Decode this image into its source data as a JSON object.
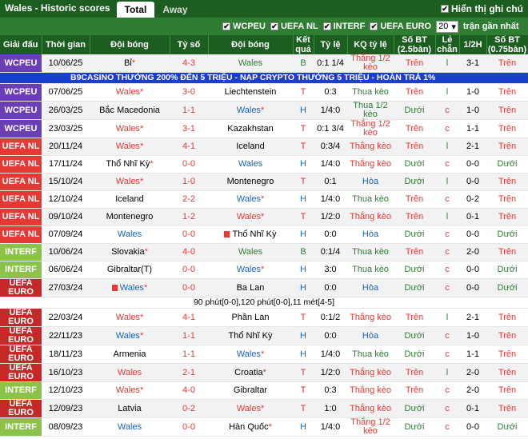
{
  "header": {
    "title": "Wales - Historic scores",
    "tabs": [
      "Total",
      "Away"
    ],
    "show_full_label": "Hiển thị ghi chú"
  },
  "filters": {
    "items": [
      "WCPEU",
      "UEFA NL",
      "INTERF",
      "UEFA EURO"
    ],
    "count_value": "20",
    "recent_label": "trận gần nhất"
  },
  "columns": [
    "Giải đấu",
    "Thời gian",
    "Đội bóng",
    "Tỷ số",
    "Đội bóng",
    "Kết quả",
    "Tỷ lệ",
    "KQ tỷ lệ",
    "Số BT (2.5bàn)",
    "Lẻ chẵn",
    "1/2H",
    "Số BT (0.75bàn)"
  ],
  "comp_colors": {
    "WCPEU": "#6a3fb5",
    "UEFA NL": "#e53935",
    "INTERF": "#8bc34a",
    "UEFA EURO": "#c62828"
  },
  "ad_text": "B9CASINO THƯỞNG 200% ĐẾN 5 TRIỆU - NẠP CRYPTO THƯỞNG 5 TRIỆU - HOÀN TRẢ 1%",
  "note_text": "90 phút[0-0],120 phút[0-0],11 mét[4-5]",
  "rows": [
    {
      "comp": "WCPEU",
      "date": "10/06/25",
      "home": "Bỉ",
      "home_star": true,
      "home_class": "",
      "score": "4-3",
      "away": "Wales",
      "away_star": false,
      "away_class": "green",
      "res": "B",
      "odds": "0:1 1/4",
      "kq": "Thắng 1/2 kèo",
      "kqc": "win",
      "ou": "Trên",
      "ouc": "over",
      "oe": "l",
      "oec": "under",
      "half": "3-1",
      "ou2": "Trên",
      "ou2c": "over"
    },
    {
      "comp": "WCPEU",
      "date": "07/06/25",
      "home": "Wales",
      "home_star": true,
      "home_class": "red",
      "score": "3-0",
      "away": "Liechtenstein",
      "away_star": false,
      "away_class": "",
      "res": "T",
      "odds": "0:3",
      "kq": "Thua kèo",
      "kqc": "lose",
      "ou": "Trên",
      "ouc": "over",
      "oe": "l",
      "oec": "under",
      "half": "1-0",
      "ou2": "Trên",
      "ou2c": "over"
    },
    {
      "comp": "WCPEU",
      "date": "26/03/25",
      "home": "Bắc Macedonia",
      "home_star": false,
      "home_class": "",
      "score": "1-1",
      "away": "Wales",
      "away_star": true,
      "away_class": "blue",
      "res": "H",
      "odds": "1/4:0",
      "kq": "Thua 1/2 kèo",
      "kqc": "lose",
      "ou": "Dưới",
      "ouc": "under",
      "oe": "c",
      "oec": "over",
      "half": "1-0",
      "ou2": "Trên",
      "ou2c": "over"
    },
    {
      "comp": "WCPEU",
      "date": "23/03/25",
      "home": "Wales",
      "home_star": true,
      "home_class": "red",
      "score": "3-1",
      "away": "Kazakhstan",
      "away_star": false,
      "away_class": "",
      "res": "T",
      "odds": "0:1 3/4",
      "kq": "Thắng 1/2 kèo",
      "kqc": "win",
      "ou": "Trên",
      "ouc": "over",
      "oe": "c",
      "oec": "over",
      "half": "1-1",
      "ou2": "Trên",
      "ou2c": "over"
    },
    {
      "comp": "UEFA NL",
      "date": "20/11/24",
      "home": "Wales",
      "home_star": true,
      "home_class": "red",
      "score": "4-1",
      "away": "Iceland",
      "away_star": false,
      "away_class": "",
      "res": "T",
      "odds": "0:3/4",
      "kq": "Thắng kèo",
      "kqc": "win",
      "ou": "Trên",
      "ouc": "over",
      "oe": "l",
      "oec": "under",
      "half": "2-1",
      "ou2": "Trên",
      "ou2c": "over"
    },
    {
      "comp": "UEFA NL",
      "date": "17/11/24",
      "home": "Thổ Nhĩ Kỳ",
      "home_star": true,
      "home_class": "",
      "score": "0-0",
      "away": "Wales",
      "away_star": false,
      "away_class": "blue",
      "res": "H",
      "odds": "1/4:0",
      "kq": "Thắng kèo",
      "kqc": "win",
      "ou": "Dưới",
      "ouc": "under",
      "oe": "c",
      "oec": "over",
      "half": "0-0",
      "ou2": "Dưới",
      "ou2c": "under"
    },
    {
      "comp": "UEFA NL",
      "date": "15/10/24",
      "home": "Wales",
      "home_star": true,
      "home_class": "red",
      "score": "1-0",
      "away": "Montenegro",
      "away_star": false,
      "away_class": "",
      "res": "T",
      "odds": "0:1",
      "kq": "Hòa",
      "kqc": "draw",
      "ou": "Dưới",
      "ouc": "under",
      "oe": "l",
      "oec": "under",
      "half": "0-0",
      "ou2": "Trên",
      "ou2c": "over"
    },
    {
      "comp": "UEFA NL",
      "date": "12/10/24",
      "home": "Iceland",
      "home_star": false,
      "home_class": "",
      "score": "2-2",
      "away": "Wales",
      "away_star": true,
      "away_class": "blue",
      "res": "H",
      "odds": "1/4:0",
      "kq": "Thua kèo",
      "kqc": "lose",
      "ou": "Trên",
      "ouc": "over",
      "oe": "c",
      "oec": "over",
      "half": "0-2",
      "ou2": "Trên",
      "ou2c": "over"
    },
    {
      "comp": "UEFA NL",
      "date": "09/10/24",
      "home": "Montenegro",
      "home_star": false,
      "home_class": "",
      "score": "1-2",
      "away": "Wales",
      "away_star": true,
      "away_class": "red",
      "res": "T",
      "odds": "1/2:0",
      "kq": "Thắng kèo",
      "kqc": "win",
      "ou": "Trên",
      "ouc": "over",
      "oe": "l",
      "oec": "under",
      "half": "0-1",
      "ou2": "Trên",
      "ou2c": "over"
    },
    {
      "comp": "UEFA NL",
      "date": "07/09/24",
      "home": "Wales",
      "home_star": false,
      "home_class": "blue",
      "score": "0-0",
      "away": "Thổ Nhĩ Kỳ",
      "away_star": false,
      "away_flag": true,
      "away_class": "",
      "res": "H",
      "odds": "0:0",
      "kq": "Hòa",
      "kqc": "draw",
      "ou": "Dưới",
      "ouc": "under",
      "oe": "c",
      "oec": "over",
      "half": "0-0",
      "ou2": "Dưới",
      "ou2c": "under"
    },
    {
      "comp": "INTERF",
      "date": "10/06/24",
      "home": "Slovakia",
      "home_star": true,
      "home_class": "",
      "score": "4-0",
      "away": "Wales",
      "away_star": false,
      "away_class": "green",
      "res": "B",
      "odds": "0:1/4",
      "kq": "Thua kèo",
      "kqc": "lose",
      "ou": "Trên",
      "ouc": "over",
      "oe": "c",
      "oec": "over",
      "half": "2-0",
      "ou2": "Trên",
      "ou2c": "over"
    },
    {
      "comp": "INTERF",
      "date": "06/06/24",
      "home": "Gibraltar(T)",
      "home_star": false,
      "home_class": "",
      "score": "0-0",
      "away": "Wales",
      "away_star": true,
      "away_class": "blue",
      "res": "H",
      "odds": "3:0",
      "kq": "Thua kèo",
      "kqc": "lose",
      "ou": "Dưới",
      "ouc": "under",
      "oe": "c",
      "oec": "over",
      "half": "0-0",
      "ou2": "Dưới",
      "ou2c": "under"
    },
    {
      "comp": "UEFA EURO",
      "date": "27/03/24",
      "home": "Wales",
      "home_star": true,
      "home_class": "blue",
      "home_flag": true,
      "score": "0-0",
      "away": "Ba Lan",
      "away_star": false,
      "away_class": "",
      "res": "H",
      "odds": "0:0",
      "kq": "Hòa",
      "kqc": "draw",
      "ou": "Dưới",
      "ouc": "under",
      "oe": "c",
      "oec": "over",
      "half": "0-0",
      "ou2": "Dưới",
      "ou2c": "under"
    },
    {
      "comp": "UEFA EURO",
      "date": "22/03/24",
      "home": "Wales",
      "home_star": true,
      "home_class": "red",
      "score": "4-1",
      "away": "Phần Lan",
      "away_star": false,
      "away_class": "",
      "res": "T",
      "odds": "0:1/2",
      "kq": "Thắng kèo",
      "kqc": "win",
      "ou": "Trên",
      "ouc": "over",
      "oe": "l",
      "oec": "under",
      "half": "2-1",
      "ou2": "Trên",
      "ou2c": "over"
    },
    {
      "comp": "UEFA EURO",
      "date": "22/11/23",
      "home": "Wales",
      "home_star": true,
      "home_class": "blue",
      "score": "1-1",
      "away": "Thổ Nhĩ Kỳ",
      "away_star": false,
      "away_class": "",
      "res": "H",
      "odds": "0:0",
      "kq": "Hòa",
      "kqc": "draw",
      "ou": "Dưới",
      "ouc": "under",
      "oe": "c",
      "oec": "over",
      "half": "1-0",
      "ou2": "Trên",
      "ou2c": "over"
    },
    {
      "comp": "UEFA EURO",
      "date": "18/11/23",
      "home": "Armenia",
      "home_star": false,
      "home_class": "",
      "score": "1-1",
      "away": "Wales",
      "away_star": true,
      "away_class": "blue",
      "res": "H",
      "odds": "1/4:0",
      "kq": "Thua kèo",
      "kqc": "lose",
      "ou": "Dưới",
      "ouc": "under",
      "oe": "c",
      "oec": "over",
      "half": "1-1",
      "ou2": "Trên",
      "ou2c": "over"
    },
    {
      "comp": "UEFA EURO",
      "date": "16/10/23",
      "home": "Wales",
      "home_star": false,
      "home_class": "red",
      "score": "2-1",
      "away": "Croatia",
      "away_star": true,
      "away_class": "",
      "res": "T",
      "odds": "1/2:0",
      "kq": "Thắng kèo",
      "kqc": "win",
      "ou": "Trên",
      "ouc": "over",
      "oe": "l",
      "oec": "under",
      "half": "2-0",
      "ou2": "Trên",
      "ou2c": "over"
    },
    {
      "comp": "INTERF",
      "date": "12/10/23",
      "home": "Wales",
      "home_star": true,
      "home_class": "red",
      "score": "4-0",
      "away": "Gibraltar",
      "away_star": false,
      "away_class": "",
      "res": "T",
      "odds": "0:3",
      "kq": "Thắng kèo",
      "kqc": "win",
      "ou": "Trên",
      "ouc": "over",
      "oe": "c",
      "oec": "over",
      "half": "2-0",
      "ou2": "Trên",
      "ou2c": "over"
    },
    {
      "comp": "UEFA EURO",
      "date": "12/09/23",
      "home": "Latvia",
      "home_star": false,
      "home_class": "",
      "score": "0-2",
      "away": "Wales",
      "away_star": true,
      "away_class": "red",
      "res": "T",
      "odds": "1:0",
      "kq": "Thắng kèo",
      "kqc": "win",
      "ou": "Dưới",
      "ouc": "under",
      "oe": "c",
      "oec": "over",
      "half": "0-1",
      "ou2": "Trên",
      "ou2c": "over"
    },
    {
      "comp": "INTERF",
      "date": "08/09/23",
      "home": "Wales",
      "home_star": false,
      "home_class": "blue",
      "score": "0-0",
      "away": "Hàn Quốc",
      "away_star": true,
      "away_class": "",
      "res": "H",
      "odds": "1/4:0",
      "kq": "Thắng 1/2 kèo",
      "kqc": "win",
      "ou": "Dưới",
      "ouc": "under",
      "oe": "c",
      "oec": "over",
      "half": "0-0",
      "ou2": "Dưới",
      "ou2c": "under"
    }
  ]
}
